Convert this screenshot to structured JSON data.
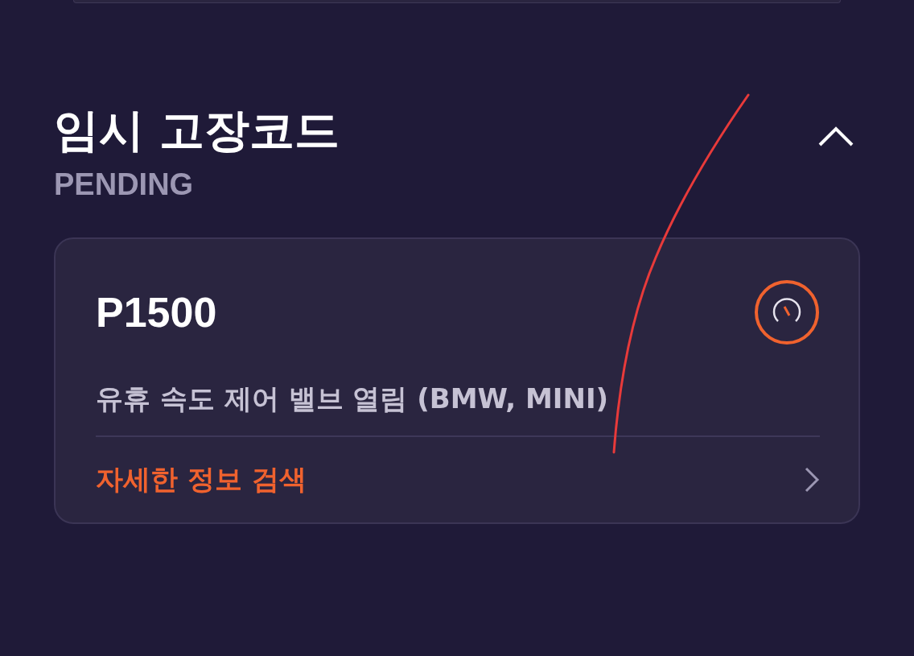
{
  "section": {
    "title": "임시 고장코드",
    "subtitle": "PENDING",
    "expanded": true
  },
  "codes": [
    {
      "code": "P1500",
      "description": "유휴 속도 제어 밸브 열림 (BMW, MINI)",
      "link": "자세한 정보 검색"
    }
  ]
}
